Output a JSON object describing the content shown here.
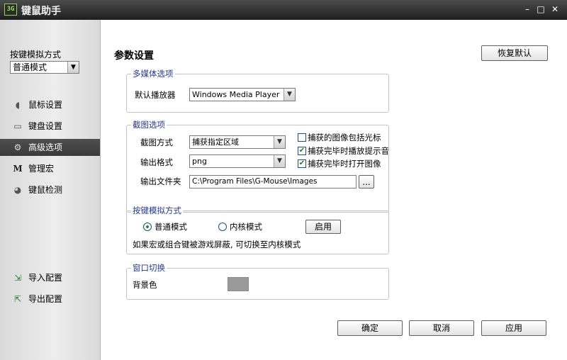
{
  "window": {
    "title": "键鼠助手",
    "icon_text": "3G",
    "minimize": "–",
    "maximize": "□",
    "close": "✕"
  },
  "sidebar": {
    "mode_label": "按键模拟方式",
    "mode_value": "普通模式",
    "items": [
      {
        "label": "鼠标设置",
        "icon": "mouse-icon"
      },
      {
        "label": "键盘设置",
        "icon": "keyboard-icon"
      },
      {
        "label": "高级选项",
        "icon": "gear-icon",
        "active": true
      },
      {
        "label": "管理宏",
        "icon": "macro-m-icon"
      },
      {
        "label": "键鼠检测",
        "icon": "detect-icon"
      }
    ],
    "import_label": "导入配置",
    "export_label": "导出配置"
  },
  "main": {
    "title": "参数设置",
    "restore_default": "恢复默认",
    "multimedia": {
      "title": "多媒体选项",
      "player_label": "默认播放器",
      "player_value": "Windows Media Player"
    },
    "screenshot": {
      "title": "截图选项",
      "method_label": "截图方式",
      "method_value": "捕获指定区域",
      "format_label": "输出格式",
      "format_value": "png",
      "folder_label": "输出文件夹",
      "folder_value": "C:\\Program Files\\G-Mouse\\Images",
      "browse_label": "...",
      "include_cursor": {
        "label": "捕获的图像包括光标",
        "checked": false
      },
      "play_sound": {
        "label": "捕获完毕时播放提示音",
        "checked": true
      },
      "open_image": {
        "label": "捕获完毕时打开图像",
        "checked": true
      }
    },
    "key_sim": {
      "title": "按键模拟方式",
      "normal_mode": "普通模式",
      "kernel_mode": "内核模式",
      "enable_button": "启用",
      "note": "如果宏或组合键被游戏屏蔽, 可切换至内核模式"
    },
    "window_switch": {
      "title": "窗口切换",
      "bg_label": "背景色",
      "bg_color": "#9a9a9a"
    },
    "ok": "确定",
    "cancel": "取消",
    "apply": "应用"
  }
}
